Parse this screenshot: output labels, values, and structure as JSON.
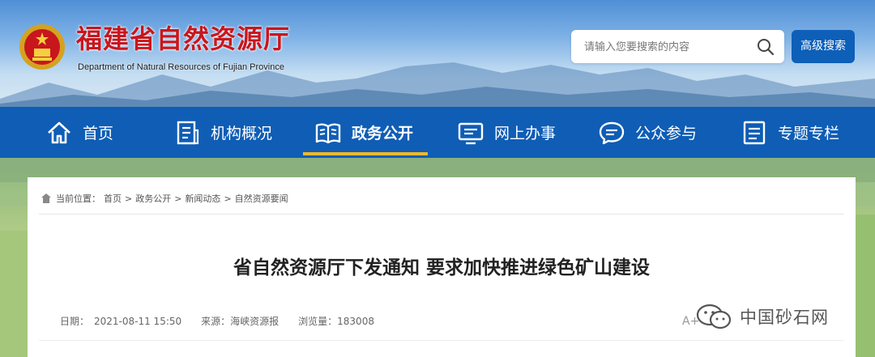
{
  "header": {
    "title": "福建省自然资源厅",
    "subtitle": "Department of Natural Resources of Fujian Province",
    "search_placeholder": "请输入您要搜索的内容",
    "advanced_search_label": "高级搜索"
  },
  "nav": {
    "items": [
      {
        "label": "首页",
        "icon": "home-icon"
      },
      {
        "label": "机构概况",
        "icon": "document-icon"
      },
      {
        "label": "政务公开",
        "icon": "book-icon"
      },
      {
        "label": "网上办事",
        "icon": "monitor-icon"
      },
      {
        "label": "公众参与",
        "icon": "chat-icon"
      },
      {
        "label": "专题专栏",
        "icon": "list-icon"
      }
    ],
    "active_index": 2
  },
  "breadcrumb": {
    "prefix": "当前位置：",
    "items": [
      "首页",
      ">",
      "政务公开",
      ">",
      "新闻动态",
      ">",
      "自然资源要闻"
    ]
  },
  "article": {
    "title": "省自然资源厅下发通知 要求加快推进绿色矿山建设",
    "date": "日期：　2021-08-11 15:50",
    "source": "来源：海峡资源报",
    "views": "浏览量：183008",
    "font_control": "A+"
  },
  "watermark": {
    "text": "中国砂石网"
  },
  "colors": {
    "nav_bg": "#0f5db5",
    "nav_active_underline": "#f0b92b",
    "title_red": "#c8161d",
    "button_blue": "#0d5fb8"
  }
}
